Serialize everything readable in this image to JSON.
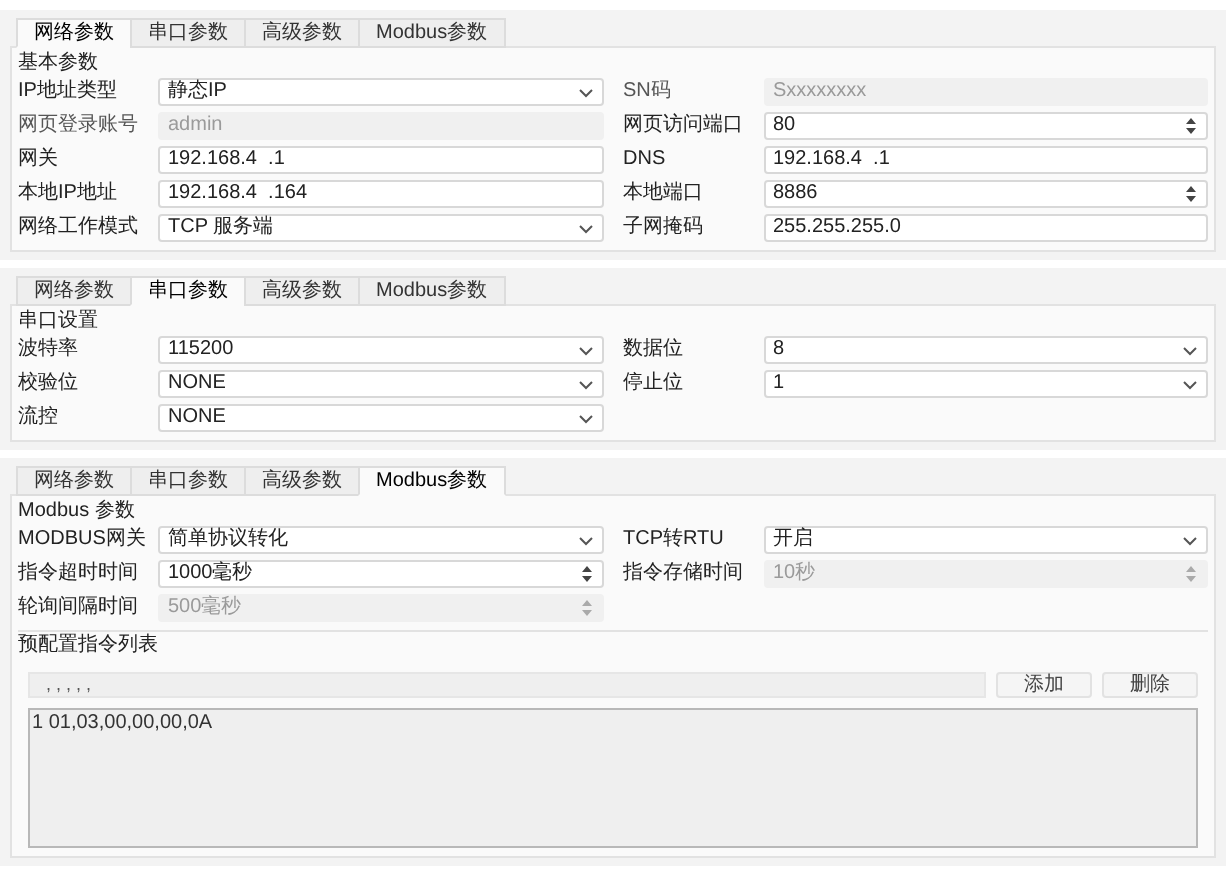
{
  "panels": [
    {
      "tabs": [
        {
          "label": "网络参数",
          "selected": true
        },
        {
          "label": "串口参数",
          "selected": false
        },
        {
          "label": "高级参数",
          "selected": false
        },
        {
          "label": "Modbus参数",
          "selected": false
        }
      ],
      "group": "基本参数",
      "rows": [
        [
          {
            "label": "IP地址类型",
            "value": "静态IP",
            "kind": "select",
            "disabled": false
          },
          {
            "label": "SN码",
            "value": "Sxxxxxxxx",
            "kind": "text",
            "disabled": true
          }
        ],
        [
          {
            "label": "网页登录账号",
            "value": "admin",
            "kind": "text",
            "disabled": true
          },
          {
            "label": "网页访问端口",
            "value": "80",
            "kind": "spin",
            "disabled": false
          }
        ],
        [
          {
            "label": "网关",
            "value": "192.168.4  .1",
            "kind": "text",
            "disabled": false
          },
          {
            "label": "DNS",
            "value": "192.168.4  .1",
            "kind": "text",
            "disabled": false
          }
        ],
        [
          {
            "label": "本地IP地址",
            "value": "192.168.4  .164",
            "kind": "text",
            "disabled": false
          },
          {
            "label": "本地端口",
            "value": "8886",
            "kind": "spin",
            "disabled": false
          }
        ],
        [
          {
            "label": "网络工作模式",
            "value": "TCP 服务端",
            "kind": "select",
            "disabled": false
          },
          {
            "label": "子网掩码",
            "value": "255.255.255.0",
            "kind": "text",
            "disabled": false
          }
        ]
      ]
    },
    {
      "tabs": [
        {
          "label": "网络参数",
          "selected": false
        },
        {
          "label": "串口参数",
          "selected": true
        },
        {
          "label": "高级参数",
          "selected": false
        },
        {
          "label": "Modbus参数",
          "selected": false
        }
      ],
      "group": "串口设置",
      "rows": [
        [
          {
            "label": "波特率",
            "value": "115200",
            "kind": "select",
            "disabled": false
          },
          {
            "label": "数据位",
            "value": "8",
            "kind": "select",
            "disabled": false
          }
        ],
        [
          {
            "label": "校验位",
            "value": "NONE",
            "kind": "select",
            "disabled": false
          },
          {
            "label": "停止位",
            "value": "1",
            "kind": "select",
            "disabled": false
          }
        ],
        [
          {
            "label": "流控",
            "value": "NONE",
            "kind": "select",
            "disabled": false
          }
        ]
      ]
    },
    {
      "tabs": [
        {
          "label": "网络参数",
          "selected": false
        },
        {
          "label": "串口参数",
          "selected": false
        },
        {
          "label": "高级参数",
          "selected": false
        },
        {
          "label": "Modbus参数",
          "selected": true
        }
      ],
      "group": "Modbus 参数",
      "rows": [
        [
          {
            "label": "MODBUS网关",
            "value": "简单协议转化",
            "kind": "select",
            "disabled": false
          },
          {
            "label": "TCP转RTU",
            "value": "开启",
            "kind": "select",
            "disabled": false
          }
        ],
        [
          {
            "label": "指令超时时间",
            "value": "1000毫秒",
            "kind": "spin",
            "disabled": false
          },
          {
            "label": "指令存储时间",
            "value": "10秒",
            "kind": "spin",
            "disabled": true
          }
        ],
        [
          {
            "label": "轮询间隔时间",
            "value": "500毫秒",
            "kind": "spin",
            "disabled": true
          }
        ]
      ],
      "list": {
        "title": "预配置指令列表",
        "input": ", , , , ,",
        "buttons": [
          "添加",
          "删除"
        ],
        "lines": [
          "1 01,03,00,00,00,0A"
        ]
      }
    }
  ]
}
